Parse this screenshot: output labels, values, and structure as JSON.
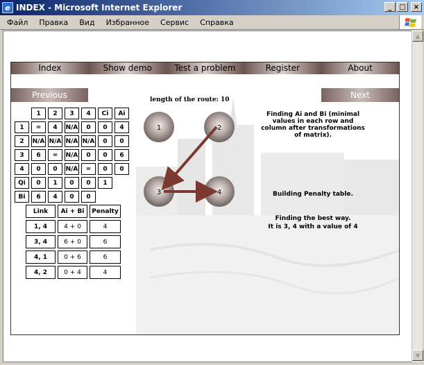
{
  "window": {
    "title": "INDEX - Microsoft Internet Explorer",
    "icon_name": "ie-icon",
    "controls": [
      "_",
      "□",
      "×"
    ]
  },
  "menu": [
    "Файл",
    "Правка",
    "Вид",
    "Избранное",
    "Сервис",
    "Справка"
  ],
  "nav": [
    "Index",
    "Show demo",
    "Test a problem",
    "Register",
    "About"
  ],
  "buttons": {
    "previous": "Previous",
    "next": "Next"
  },
  "route_length": "length of the route: 10",
  "matrix": {
    "header": [
      "1",
      "2",
      "3",
      "4",
      "Ci",
      "Ai"
    ],
    "rows": [
      [
        "1",
        "=",
        "4",
        "N/A",
        "0",
        "0",
        "4"
      ],
      [
        "2",
        "N/A",
        "N/A",
        "N/A",
        "N/A",
        "0",
        "0"
      ],
      [
        "3",
        "6",
        "=",
        "N/A",
        "0",
        "0",
        "6"
      ],
      [
        "4",
        "0",
        "0",
        "N/A",
        "=",
        "0",
        "0"
      ]
    ],
    "qi": [
      "Qi",
      "0",
      "1",
      "0",
      "0",
      "1"
    ],
    "bi": [
      "Bi",
      "6",
      "4",
      "0",
      "0"
    ]
  },
  "penalty": {
    "header": [
      "Link",
      "Ai + Bi",
      "Penalty"
    ],
    "rows": [
      [
        "1, 4",
        "4 + 0",
        "4"
      ],
      [
        "3, 4",
        "6 + 0",
        "6"
      ],
      [
        "4, 1",
        "0 + 6",
        "6"
      ],
      [
        "4, 2",
        "0 + 4",
        "4"
      ]
    ]
  },
  "graph": {
    "nodes": [
      "1",
      "2",
      "3",
      "4"
    ],
    "edges": [
      [
        "2",
        "3"
      ],
      [
        "3",
        "4"
      ]
    ]
  },
  "info": {
    "finding": "Finding Ai and Bi (minimal values in each row and column after transformations of matrix).",
    "building": "Building Penalty table.",
    "best_line1": "Finding the best way.",
    "best_line2": "It is 3,  4 with a value of 4"
  },
  "colors": {
    "nav_dark": "#6c5450",
    "node": "#8e807d",
    "arrow": "#7a3a30"
  }
}
